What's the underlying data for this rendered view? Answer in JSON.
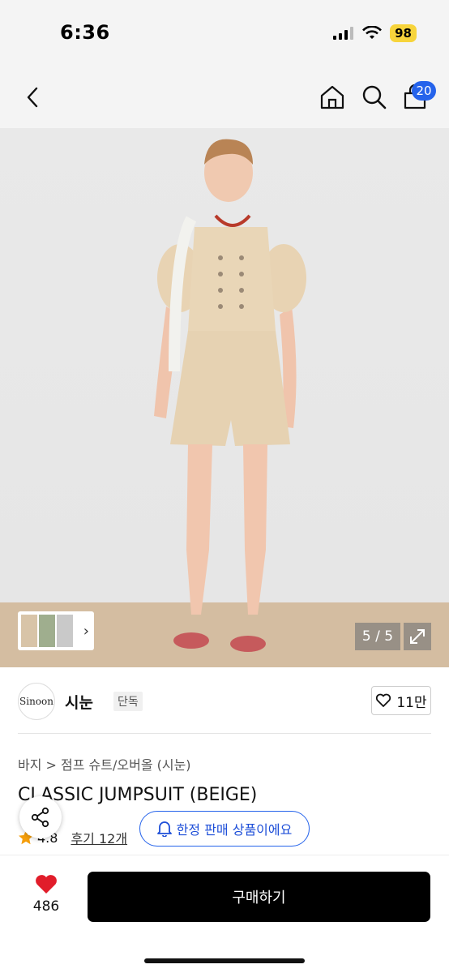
{
  "status_bar": {
    "time": "6:36",
    "battery": "98"
  },
  "nav": {
    "cart_count": "20",
    "icons": [
      "back-chevron-icon",
      "home-icon",
      "search-icon",
      "cart-icon"
    ]
  },
  "gallery": {
    "counter": "5 / 5",
    "thumb_arrow": "›"
  },
  "brand": {
    "logo_text": "Sinoon",
    "name": "시눈",
    "tag": "단독",
    "likes": "11만"
  },
  "breadcrumb": "바지 > 점프 슈트/오버올 (시눈)",
  "product": {
    "title": "CLASSIC JUMPSUIT (BEIGE)"
  },
  "rating": {
    "score": "4.8",
    "reviews": "후기 12개"
  },
  "limited": {
    "label": "한정 판매 상품이에요"
  },
  "bottom": {
    "wish_count": "486",
    "buy_label": "구매하기"
  },
  "colors": {
    "accent_blue": "#2563eb",
    "heart_red": "#e11d2a",
    "star": "#f59e0b",
    "buy_button": "#000000"
  }
}
